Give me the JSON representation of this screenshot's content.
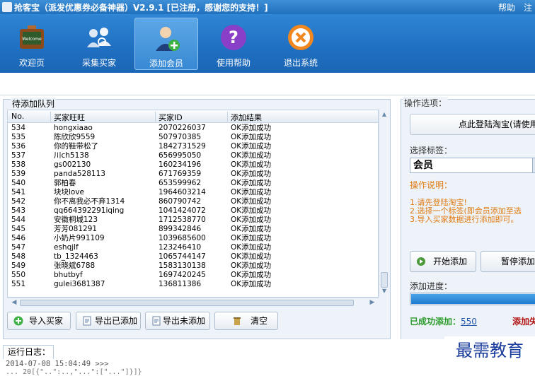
{
  "window": {
    "title": "抢客宝（派发优惠券必备神器）V2.9.1 [已注册，感谢您的支持！]",
    "help": "帮助",
    "register": "注"
  },
  "toolbar": {
    "items": [
      {
        "label": "欢迎页",
        "icon": "welcome-board-icon"
      },
      {
        "label": "采集买家",
        "icon": "collect-buyers-icon"
      },
      {
        "label": "添加会员",
        "icon": "add-member-icon"
      },
      {
        "label": "使用帮助",
        "icon": "help-icon"
      },
      {
        "label": "退出系统",
        "icon": "exit-icon"
      }
    ]
  },
  "queue": {
    "title": "待添加队列",
    "columns": [
      "No.",
      "买家旺旺",
      "买家ID",
      "添加结果"
    ],
    "rows": [
      [
        "534",
        "hongxiaao",
        "2070226037",
        "OK添加成功"
      ],
      [
        "535",
        "陈欣欣9559",
        "507970385",
        "OK添加成功"
      ],
      [
        "536",
        "你的鞋带松了",
        "1842731529",
        "OK添加成功"
      ],
      [
        "537",
        "川ch5138",
        "656995050",
        "OK添加成功"
      ],
      [
        "538",
        "gs002130",
        "160234196",
        "OK添加成功"
      ],
      [
        "539",
        "panda528113",
        "671769359",
        "OK添加成功"
      ],
      [
        "540",
        "郭柏春",
        "653599962",
        "OK添加成功"
      ],
      [
        "541",
        "块块love",
        "1964603214",
        "OK添加成功"
      ],
      [
        "542",
        "你不离我必不弃1314",
        "860790742",
        "OK添加成功"
      ],
      [
        "543",
        "qq664392291iqing",
        "1041424072",
        "OK添加成功"
      ],
      [
        "544",
        "安徽桐城123",
        "1712538770",
        "OK添加成功"
      ],
      [
        "545",
        "芳芳081291",
        "899342846",
        "OK添加成功"
      ],
      [
        "546",
        "小奶片991109",
        "1039685600",
        "OK添加成功"
      ],
      [
        "547",
        "eshqjlf",
        "123246410",
        "OK添加成功"
      ],
      [
        "548",
        "tb_1324463",
        "1065744147",
        "OK添加成功"
      ],
      [
        "549",
        "张晓斌6788",
        "1583130138",
        "OK添加成功"
      ],
      [
        "550",
        "bhutbyf",
        "1697420245",
        "OK添加成功"
      ],
      [
        "551",
        "gulei3681387",
        "136811386",
        "OK添加成功"
      ]
    ]
  },
  "buttons": {
    "import": "导入买家",
    "export_added": "导出已添加",
    "export_not_added": "导出未添加",
    "clear": "清空"
  },
  "options": {
    "title": "操作选项：",
    "login_button": "点此登陆淘宝(请使用",
    "tag_label": "选择标签：",
    "tag_value": "会员",
    "instructions_title": "操作说明：",
    "instructions": [
      "1.请先登陆淘宝!",
      "2.选择一个标签(即会员添加至选",
      "3.导入买家数据进行添加即可。"
    ],
    "start_button": "开始添加",
    "pause_button": "暂停添加",
    "progress_label": "添加进度：",
    "progress_fraction": 1.0,
    "success_label": "已成功添加：",
    "success_count": "550",
    "failed_label": "添加失"
  },
  "log": {
    "tab": "运行日志：",
    "line1": "2014-07-08 15:04:49 >>>",
    "line2": "... 20[{\"..\":..,\"...\":[\"...\"]}]}"
  },
  "watermark": "最需教育"
}
